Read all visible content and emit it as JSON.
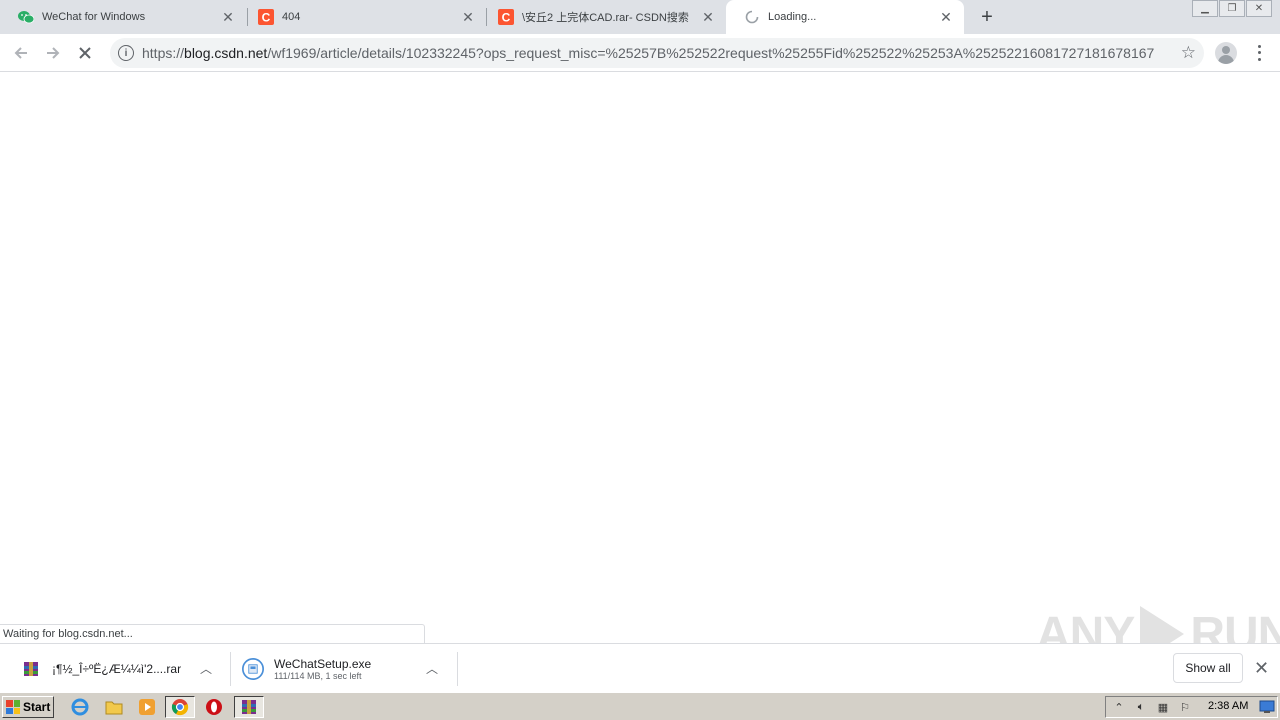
{
  "tabs": [
    {
      "title": "WeChat for Windows",
      "icon": "wechat-icon"
    },
    {
      "title": "404",
      "icon": "csdn-icon"
    },
    {
      "title": "\\安丘2 上完体CAD.rar- CSDN搜索",
      "icon": "csdn-icon"
    },
    {
      "title": "Loading...",
      "icon": "loading-spinner-icon",
      "active": true
    }
  ],
  "toolbar": {
    "url_scheme": "https://",
    "url_host": "blog.csdn.net",
    "url_path": "/wf1969/article/details/102332245?ops_request_misc=%25257B%252522request%25255Fid%252522%25253A%252522160817271816781678..."
  },
  "status": {
    "text": "Waiting for blog.csdn.net..."
  },
  "watermark": {
    "left": "ANY",
    "right": "RUN"
  },
  "downloads": [
    {
      "name": "¡¶½_Î÷ºË¿Æ¼¼ì'2....rar",
      "sub": ""
    },
    {
      "name": "WeChatSetup.exe",
      "sub": "111/114 MB, 1 sec left"
    }
  ],
  "shelf": {
    "show_all": "Show all"
  },
  "taskbar": {
    "start": "Start",
    "clock": "2:38 AM"
  },
  "colors": {
    "csdn": "#fc5531",
    "wechat": "#2aae67",
    "tabstrip": "#dee1e6"
  }
}
